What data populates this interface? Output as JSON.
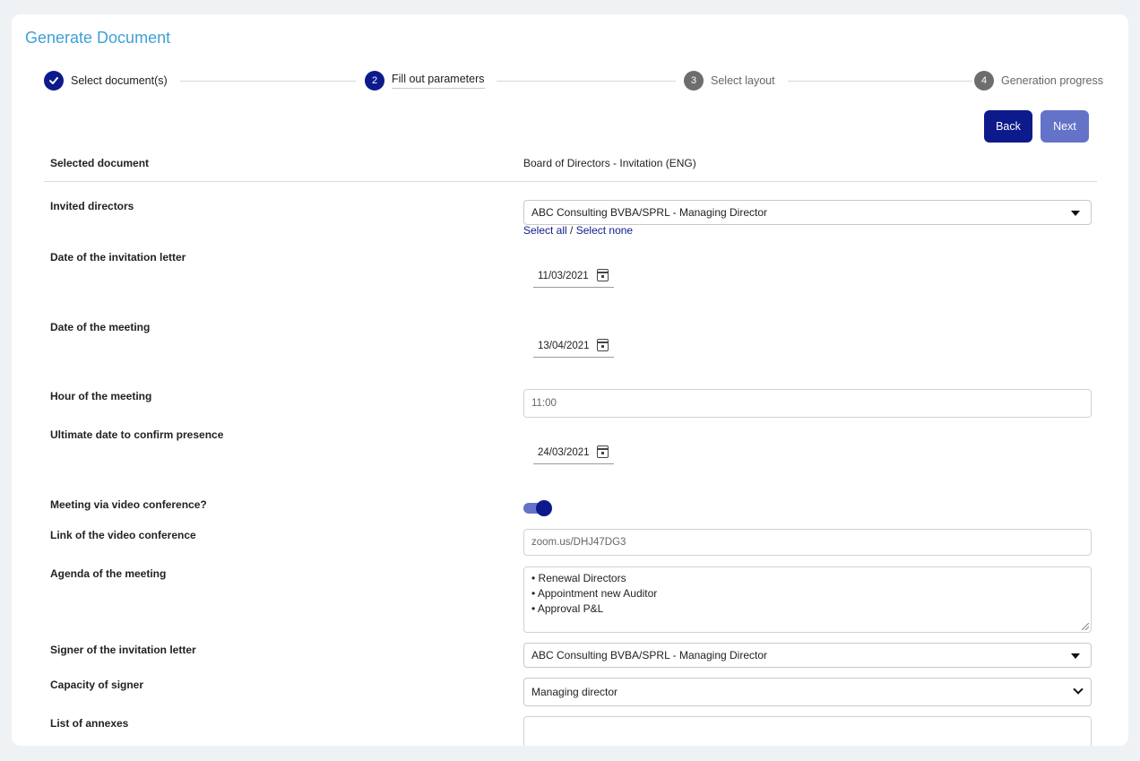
{
  "page": {
    "title": "Generate Document"
  },
  "stepper": {
    "steps": [
      {
        "number": "",
        "label": "Select document(s)",
        "state": "done"
      },
      {
        "number": "2",
        "label": "Fill out parameters",
        "state": "active"
      },
      {
        "number": "3",
        "label": "Select layout",
        "state": "todo"
      },
      {
        "number": "4",
        "label": "Generation progress",
        "state": "todo"
      }
    ]
  },
  "buttons": {
    "back": "Back",
    "next": "Next"
  },
  "form": {
    "selected_document": {
      "label": "Selected document",
      "value": "Board of Directors - Invitation (ENG)"
    },
    "invited_directors": {
      "label": "Invited directors",
      "value": "ABC Consulting BVBA/SPRL - Managing Director",
      "select_all": "Select all",
      "separator": " / ",
      "select_none": "Select none"
    },
    "invitation_date": {
      "label": "Date of the invitation letter",
      "value": "11/03/2021"
    },
    "meeting_date": {
      "label": "Date of the meeting",
      "value": "13/04/2021"
    },
    "meeting_hour": {
      "label": "Hour of the meeting",
      "value": "11:00"
    },
    "confirm_date": {
      "label": "Ultimate date to confirm presence",
      "value": "24/03/2021"
    },
    "video_conference": {
      "label": "Meeting via video conference?",
      "enabled": true
    },
    "video_link": {
      "label": "Link of the video conference",
      "value": "zoom.us/DHJ47DG3"
    },
    "agenda": {
      "label": "Agenda of the meeting",
      "items": [
        "• Renewal Directors",
        "• Appointment new Auditor",
        "• Approval P&L"
      ]
    },
    "signer": {
      "label": "Signer of the invitation letter",
      "value": "ABC Consulting BVBA/SPRL - Managing Director"
    },
    "capacity": {
      "label": "Capacity of signer",
      "value": "Managing director"
    },
    "annexes": {
      "label": "List of annexes",
      "value": ""
    }
  },
  "icons": {
    "step_done": "check-icon",
    "date_picker": "calendar-icon",
    "select_caret": "caret-down-icon",
    "select_chevron": "chevron-down-icon"
  },
  "colors": {
    "primary": "#0d1a8c",
    "primary_light": "#6472c8",
    "title": "#3fa0d6",
    "step_inactive": "#6d6d6d"
  }
}
